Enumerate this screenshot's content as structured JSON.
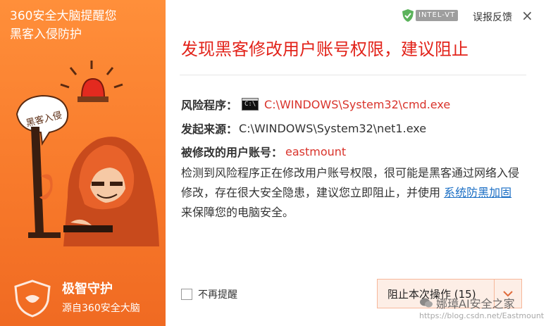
{
  "left_panel": {
    "title_line1": "360安全大脑提醒您",
    "title_line2": "黑客入侵防护",
    "bubble_text": "黑客入侵",
    "brand_name": "极智守护",
    "brand_sub": "源自360安全大脑"
  },
  "header": {
    "intel_badge": "INTEL-VT",
    "feedback_label": "误报反馈",
    "close_icon": "×"
  },
  "alert": {
    "headline": "发现黑客修改用户账号权限，建议阻止",
    "risk_program_label": "风险程序：",
    "risk_program_value": "C:\\WINDOWS\\System32\\cmd.exe",
    "source_label": "发起来源：",
    "source_value": "C:\\WINDOWS\\System32\\net1.exe",
    "account_label": "被修改的用户账号：",
    "account_value": "eastmount",
    "description_text": "检测到风险程序正在修改用户账号权限，很可能是黑客通过网络入侵修改，存在很大安全隐患，建议您立即阻止，并使用 ",
    "description_link": "系统防黑加固",
    "description_tail": " 来保障您的电脑安全。"
  },
  "footer": {
    "no_remind_label": "不再提醒",
    "block_button_label": "阻止本次操作 (15)",
    "dropdown_icon": "chevron-down-icon"
  },
  "watermark": {
    "text": "娜璋AI安全之家",
    "url": "https://blog.csdn.net/Eastmount"
  },
  "colors": {
    "accent_orange": "#f7782a",
    "alert_red": "#e2231a",
    "link_blue": "#1a6ec4"
  }
}
